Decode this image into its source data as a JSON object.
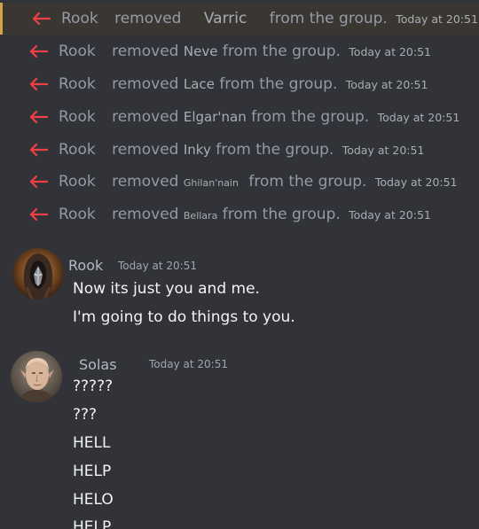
{
  "system_messages": [
    {
      "actor": "Rook",
      "verb": "removed",
      "target": "Varric",
      "suffix": "from the group.",
      "time": "Today at 20:51"
    },
    {
      "actor": "Rook",
      "verb": "removed",
      "target": "Neve",
      "suffix": "from the group.",
      "time": "Today at 20:51"
    },
    {
      "actor": "Rook",
      "verb": "removed",
      "target": "Lace",
      "suffix": "from the group.",
      "time": "Today at 20:51"
    },
    {
      "actor": "Rook",
      "verb": "removed",
      "target": "Elgar'nan",
      "suffix": "from the group.",
      "time": "Today at 20:51"
    },
    {
      "actor": "Rook",
      "verb": "removed",
      "target": "Inky",
      "suffix": "from the group.",
      "time": "Today at 20:51"
    },
    {
      "actor": "Rook",
      "verb": "removed",
      "target": "Ghilan'nain",
      "suffix": "from the group.",
      "time": "Today at 20:51"
    },
    {
      "actor": "Rook",
      "verb": "removed",
      "target": "Bellara",
      "suffix": "from the group.",
      "time": "Today at 20:51"
    }
  ],
  "messages": [
    {
      "author": "Rook",
      "time": "Today at 20:51",
      "lines": [
        "Now its just you and me.",
        "I'm going to do things to you."
      ]
    },
    {
      "author": "Solas",
      "time": "Today at 20:51",
      "lines": [
        "?????",
        "???",
        "HELL",
        "HELP",
        "HELO",
        "HELP"
      ]
    }
  ],
  "colors": {
    "background": "#313338",
    "arrow": "#f23f43",
    "highlight_bar": "#d4a348"
  },
  "icons": {
    "system_arrow": "left-arrow-icon"
  }
}
